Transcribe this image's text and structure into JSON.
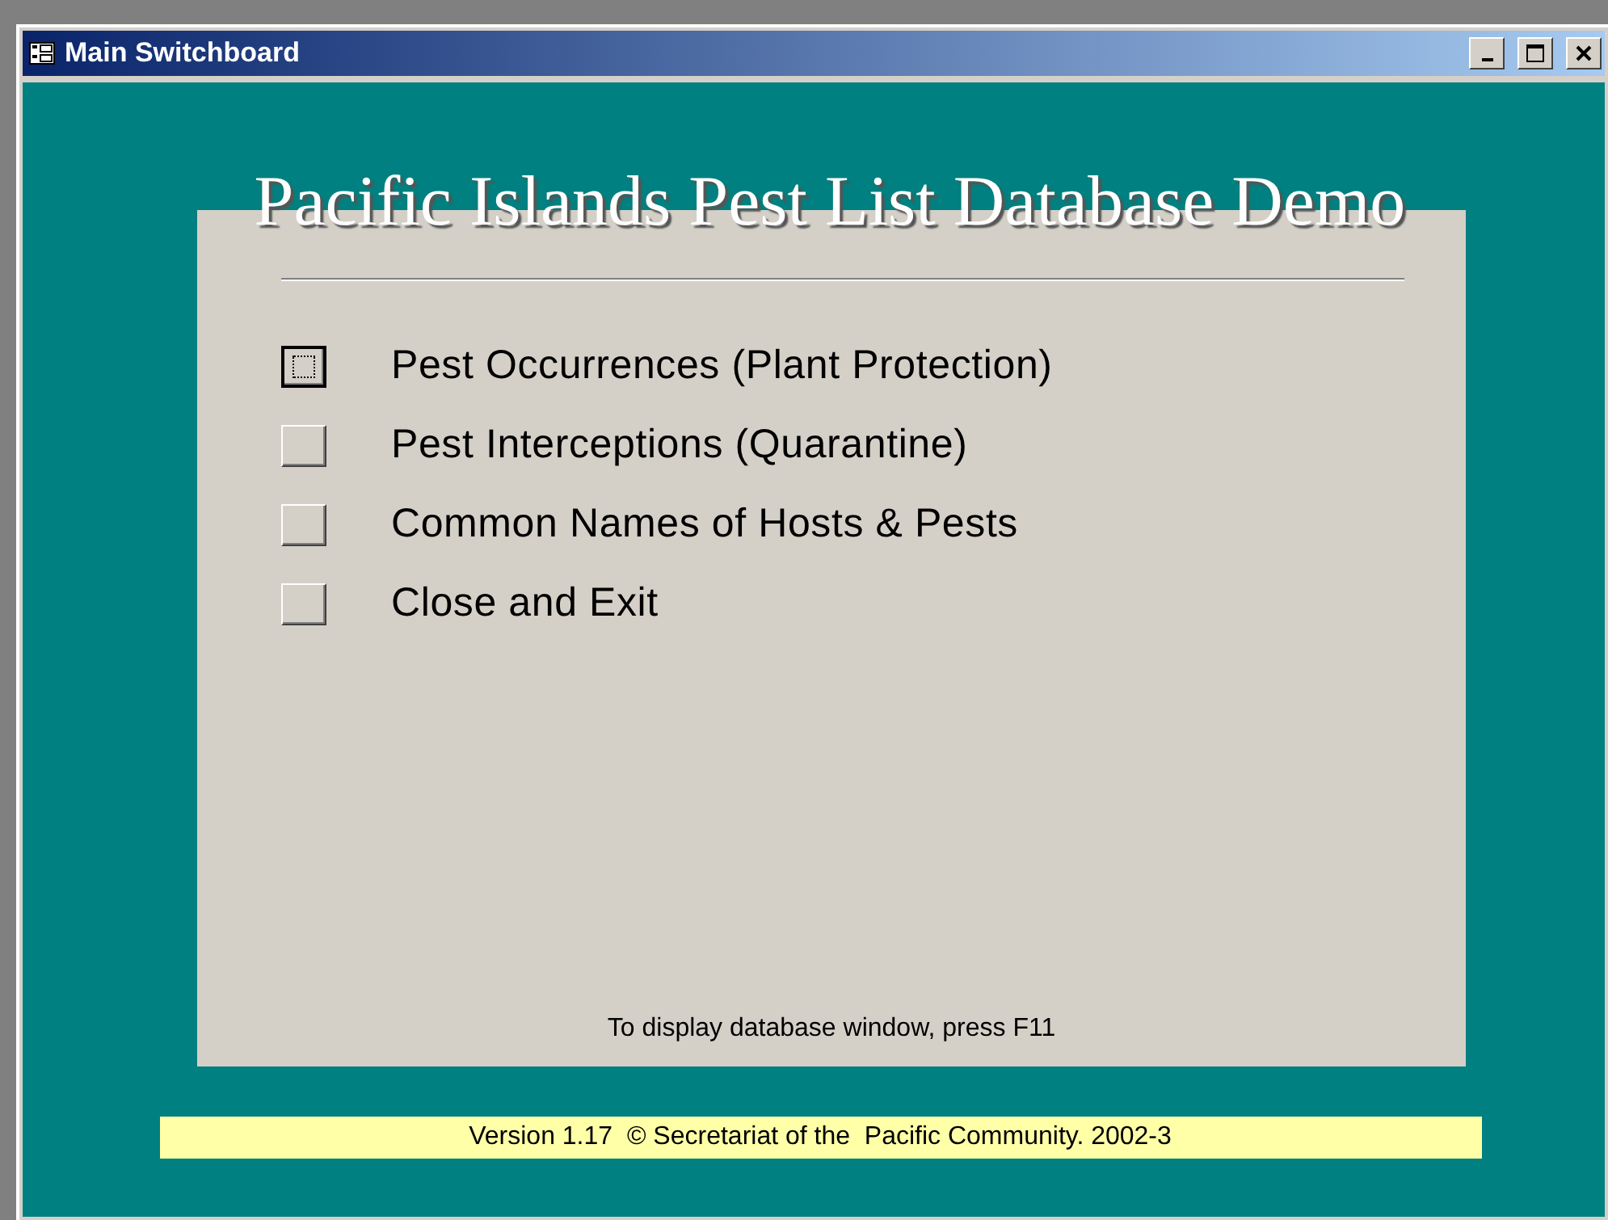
{
  "window": {
    "title": "Main Switchboard"
  },
  "heading": "Pacific Islands Pest List Database Demo",
  "items": [
    {
      "label": "Pest Occurrences (Plant Protection)",
      "selected": true
    },
    {
      "label": "Pest Interceptions (Quarantine)",
      "selected": false
    },
    {
      "label": "Common Names of Hosts & Pests",
      "selected": false
    },
    {
      "label": "Close and Exit",
      "selected": false
    }
  ],
  "hint": "To display database window, press F11",
  "version": "Version 1.17  © Secretariat of the  Pacific Community. 2002-3"
}
